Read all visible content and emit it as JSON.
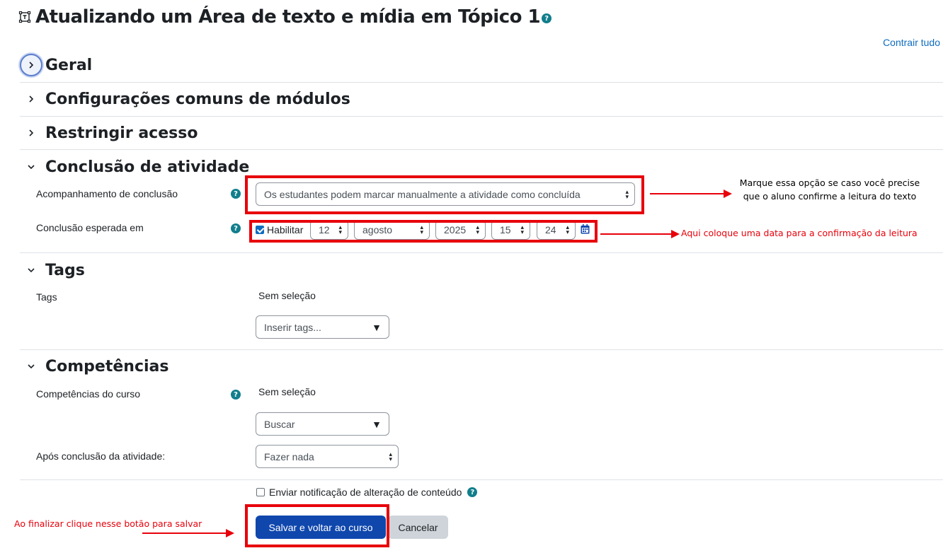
{
  "header": {
    "title": "Atualizando um Área de texto e mídia em Tópico 1",
    "help_glyph": "?",
    "collapse_all": "Contrair tudo"
  },
  "sections": {
    "general": "Geral",
    "common": "Configurações comuns de módulos",
    "restrict": "Restringir acesso",
    "completion": "Conclusão de atividade",
    "tags": "Tags",
    "competencies": "Competências"
  },
  "completion": {
    "tracking_label": "Acompanhamento de conclusão",
    "tracking_value": "Os estudantes podem marcar manualmente a atividade como concluída",
    "expected_label": "Conclusão esperada em",
    "enable_label": "Habilitar",
    "day": "12",
    "month": "agosto",
    "year": "2025",
    "hour": "15",
    "minute": "24"
  },
  "tags": {
    "label": "Tags",
    "no_selection": "Sem seleção",
    "placeholder": "Inserir tags..."
  },
  "competencies": {
    "course_label": "Competências do curso",
    "no_selection": "Sem seleção",
    "search_placeholder": "Buscar",
    "after_label": "Após conclusão da atividade:",
    "after_value": "Fazer nada"
  },
  "notify": {
    "label": "Enviar notificação de alteração de conteúdo"
  },
  "buttons": {
    "save": "Salvar e voltar ao curso",
    "cancel": "Cancelar"
  },
  "annotations": {
    "note1_line1": "Marque essa opção se caso você precise",
    "note1_line2": "que o aluno confirme a leitura do texto",
    "note2": "Aqui coloque uma data para a confirmação da leitura",
    "note3": "Ao finalizar clique nesse botão para salvar"
  },
  "colors": {
    "accent": "#0f47ad",
    "link": "#0f6cbf",
    "annotation": "#e8000b",
    "help": "#117e8c"
  },
  "icons": {
    "module": "text-media-icon",
    "expand": "chevron-right-icon",
    "collapse": "chevron-down-icon",
    "calendar": "calendar-icon",
    "help": "help-icon"
  }
}
